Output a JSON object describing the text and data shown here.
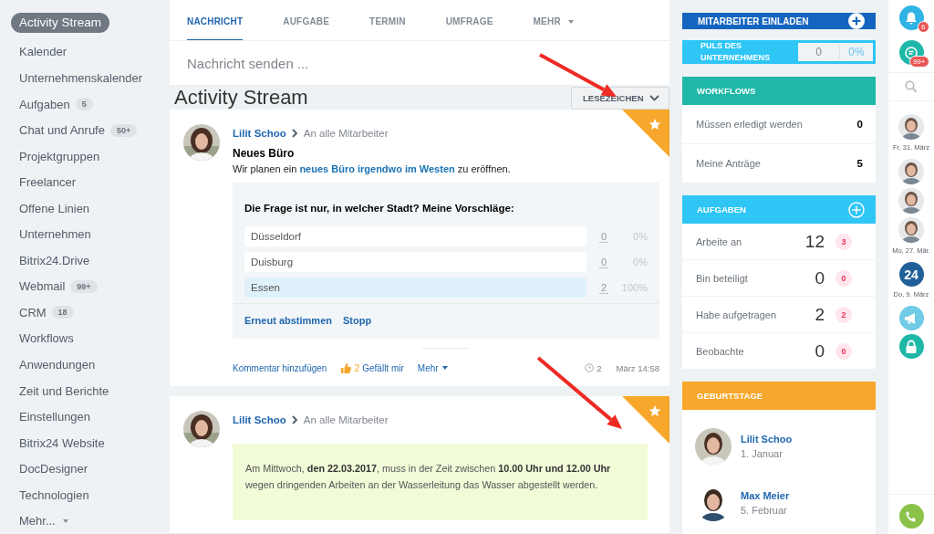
{
  "sidebar": {
    "items": [
      {
        "label": "Activity Stream",
        "selected": true
      },
      {
        "label": "Kalender",
        "selected": false
      },
      {
        "label": "Unternehmenskalender",
        "selected": false
      },
      {
        "label": "Aufgaben",
        "badge": "5",
        "selected": false
      },
      {
        "label": "Chat und Anrufe",
        "badge": "50+",
        "selected": false
      },
      {
        "label": "Projektgruppen",
        "selected": false
      },
      {
        "label": "Freelancer",
        "selected": false
      },
      {
        "label": "Offene Linien",
        "selected": false
      },
      {
        "label": "Unternehmen",
        "selected": false
      },
      {
        "label": "Bitrix24.Drive",
        "selected": false
      },
      {
        "label": "Webmail",
        "badge": "99+",
        "selected": false
      },
      {
        "label": "CRM",
        "badge": "18",
        "selected": false
      },
      {
        "label": "Workflows",
        "selected": false
      },
      {
        "label": "Anwendungen",
        "selected": false
      },
      {
        "label": "Zeit und Berichte",
        "selected": false
      },
      {
        "label": "Einstellungen",
        "selected": false
      },
      {
        "label": "Bitrix24 Website",
        "selected": false
      },
      {
        "label": "DocDesigner",
        "selected": false
      },
      {
        "label": "Technologien",
        "selected": false
      },
      {
        "label": "Mehr...",
        "selected": false,
        "dropdown": true
      }
    ]
  },
  "composer": {
    "tabs": [
      {
        "label": "NACHRICHT",
        "selected": true
      },
      {
        "label": "AUFGABE",
        "selected": false
      },
      {
        "label": "TERMIN",
        "selected": false
      },
      {
        "label": "UMFRAGE",
        "selected": false
      },
      {
        "label": "MEHR",
        "selected": false,
        "dropdown": true
      }
    ],
    "placeholder": "Nachricht senden ..."
  },
  "page_title": "Activity Stream",
  "filter_button": "LESEZEICHEN",
  "posts": [
    {
      "kind": "poll",
      "favorite": true,
      "author": "Lilit Schoo",
      "audience": "An alle Mitarbeiter",
      "title": "Neues Büro",
      "text_before": "Wir planen ein",
      "link": "neues Büro irgendwo im Westen",
      "text_after": "zu eröffnen.",
      "question": "Die Frage ist nur, in welcher Stadt? Meine Vorschläge:",
      "options": [
        {
          "label": "Düsseldorf",
          "count": "0",
          "percent": "0%",
          "level": 0
        },
        {
          "label": "Duisburg",
          "count": "0",
          "percent": "0%",
          "level": 0
        },
        {
          "label": "Essen",
          "count": "2",
          "percent": "100%",
          "level": 1
        }
      ],
      "poll_actions": [
        "Erneut abstimmen",
        "Stopp"
      ],
      "comment": "Kommentar hinzufügen",
      "likes": "2",
      "like_label": "Gefällt mir",
      "more": "Mehr",
      "time_parts": [
        "2",
        "März 14:58"
      ]
    },
    {
      "kind": "notice",
      "favorite": true,
      "author": "Lilit Schoo",
      "audience": "An alle Mitarbeiter",
      "message": "Am Mittwoch, **den 22.03.2017**, muss in der Zeit zwischen **10.00 Uhr und 12.00 Uhr** wegen dringenden Arbeiten an der Wasserleitung das Wasser abgestellt werden."
    }
  ],
  "invite": {
    "label": "MITARBEITER EINLADEN"
  },
  "pulse": {
    "label": "PULS DES UNTERNEHMENS",
    "count": "0",
    "percent": "0%"
  },
  "workflows": {
    "title": "WORKFLOWS",
    "rows": [
      {
        "label": "Müssen erledigt werden",
        "value": "0"
      },
      {
        "label": "Meine Anträge",
        "value": "5"
      }
    ]
  },
  "tasks": {
    "title": "AUFGABEN",
    "rows": [
      {
        "label": "Arbeite an",
        "value": "12",
        "badge": "3"
      },
      {
        "label": "Bin beteiligt",
        "value": "0",
        "badge": "0"
      },
      {
        "label": "Habe aufgetragen",
        "value": "2",
        "badge": "2"
      },
      {
        "label": "Beobachte",
        "value": "0",
        "badge": "0"
      }
    ]
  },
  "birthdays": {
    "title": "GEBURTSTAGE",
    "people": [
      {
        "name": "Lilit Schoo",
        "date": "1. Januar"
      },
      {
        "name": "Max Meier",
        "date": "5. Februar"
      }
    ]
  },
  "right_bar": {
    "notifications": "6",
    "messages": "99+",
    "items": [
      {
        "kind": "avatar"
      },
      {
        "kind": "date",
        "label": "Fr, 31. März"
      },
      {
        "kind": "avatar"
      },
      {
        "kind": "avatar"
      },
      {
        "kind": "avatar"
      },
      {
        "kind": "date",
        "label": "Mo, 27. Mär."
      },
      {
        "kind": "logo",
        "label": "24"
      },
      {
        "kind": "date",
        "label": "Do, 9. März"
      },
      {
        "kind": "megaphone"
      },
      {
        "kind": "lock"
      }
    ]
  }
}
